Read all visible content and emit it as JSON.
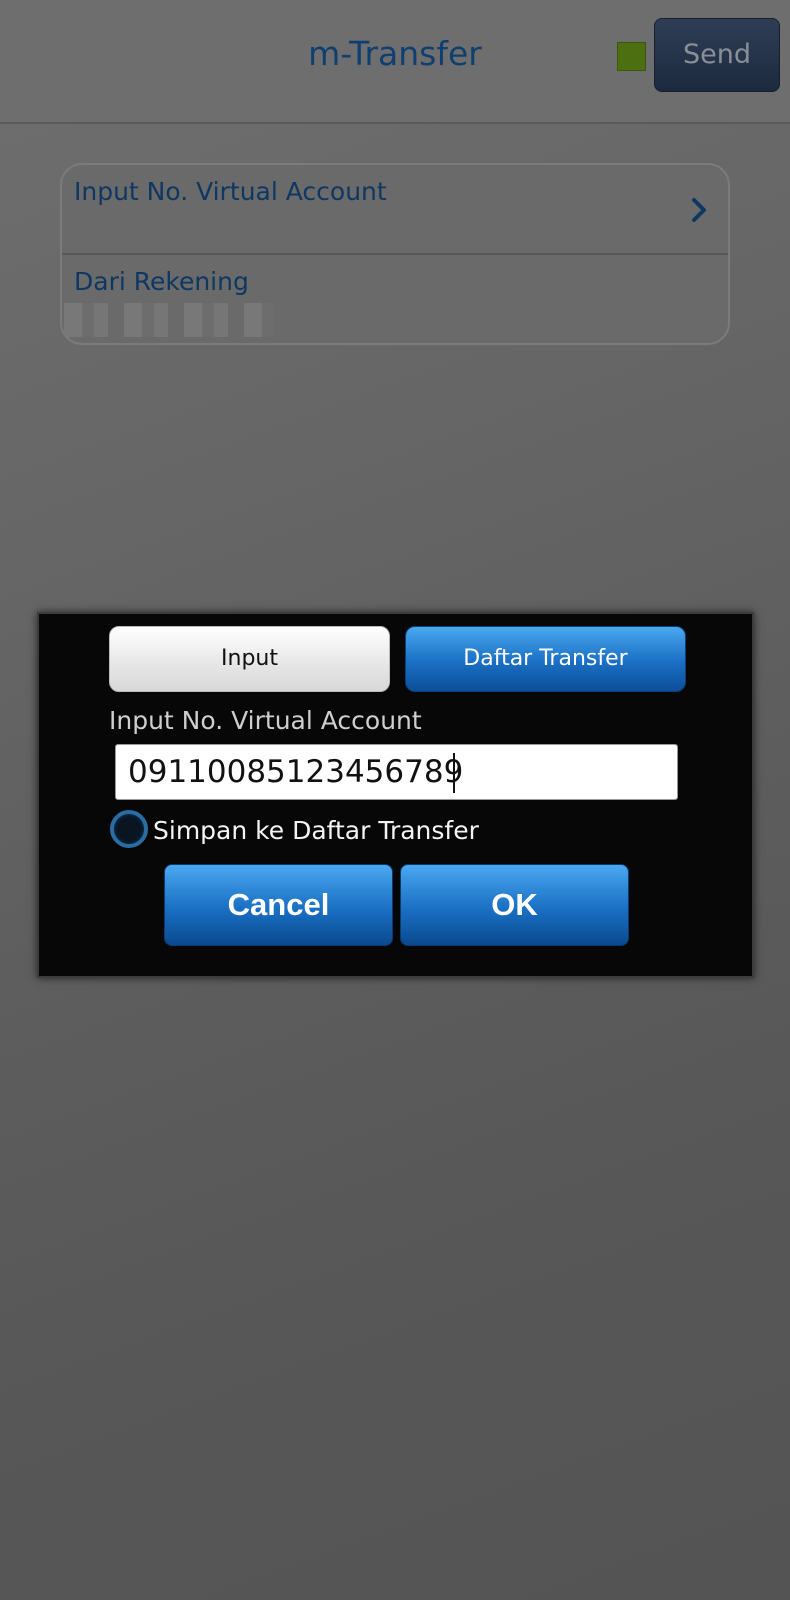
{
  "header": {
    "title": "m-Transfer",
    "send_label": "Send",
    "indicator_color": "#4e6e12"
  },
  "form": {
    "virtual_account_label": "Input No. Virtual Account",
    "from_account_label": "Dari Rekening"
  },
  "dialog": {
    "tab_input_label": "Input",
    "tab_list_label": "Daftar Transfer",
    "field_label": "Input No. Virtual Account",
    "va_number_value": "09110085123456789",
    "save_checkbox_label": "Simpan ke Daftar Transfer",
    "save_checked": false,
    "cancel_label": "Cancel",
    "ok_label": "OK",
    "accent_color": "#1a6fc4"
  }
}
